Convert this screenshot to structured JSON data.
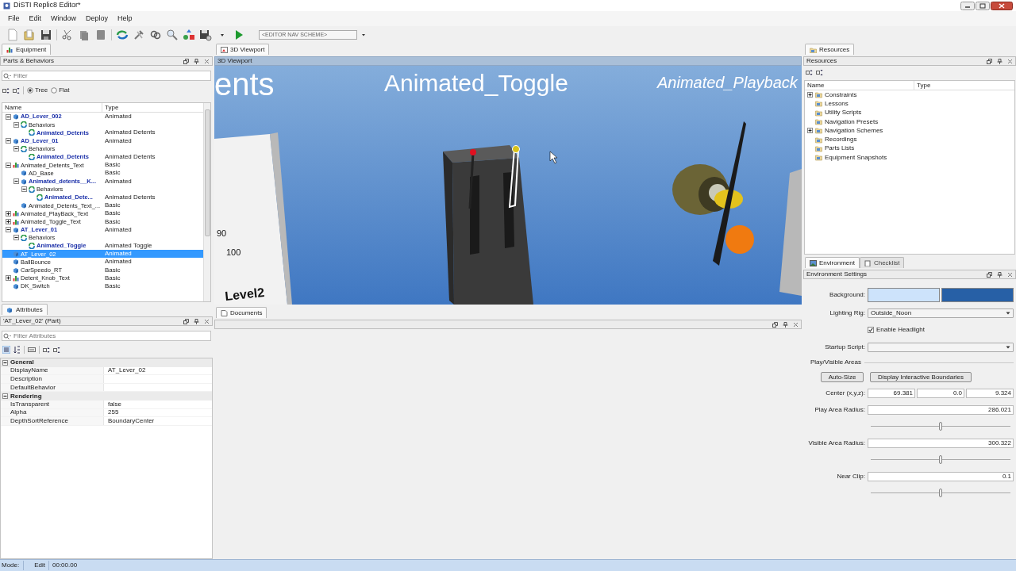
{
  "window": {
    "title": "DiSTI Replic8 Editor*"
  },
  "menu": [
    "File",
    "Edit",
    "Window",
    "Deploy",
    "Help"
  ],
  "toolbar": {
    "nav_scheme": "<EDITOR NAV SCHEME>"
  },
  "left_panel": {
    "tab": "Equipment",
    "title": "Parts & Behaviors",
    "filter_placeholder": "Filter",
    "view_modes": [
      {
        "label": "Tree",
        "selected": true
      },
      {
        "label": "Flat",
        "selected": false
      }
    ],
    "columns": [
      "Name",
      "Type"
    ],
    "tree": [
      {
        "name": "AD_Lever_002",
        "type": "Animated",
        "kind": "part",
        "emphasized": true,
        "expanded": true,
        "selected": false,
        "children": [
          {
            "name": "Behaviors",
            "kind": "behavior",
            "emphasized": false,
            "expanded": true,
            "selected": false,
            "children": [
              {
                "name": "Animated_Detents",
                "type": "Animated Detents",
                "kind": "behavior",
                "emphasized": true,
                "selected": false
              }
            ]
          }
        ]
      },
      {
        "name": "AD_Lever_01",
        "type": "Animated",
        "kind": "part",
        "emphasized": true,
        "expanded": true,
        "selected": false,
        "children": [
          {
            "name": "Behaviors",
            "kind": "behavior",
            "emphasized": false,
            "expanded": true,
            "selected": false,
            "children": [
              {
                "name": "Animated_Detents",
                "type": "Animated Detents",
                "kind": "behavior",
                "emphasized": true,
                "selected": false
              }
            ]
          }
        ]
      },
      {
        "name": "Animated_Detents_Text",
        "type": "Basic",
        "kind": "group",
        "emphasized": false,
        "expanded": true,
        "selected": false,
        "children": [
          {
            "name": "AD_Base",
            "type": "Basic",
            "kind": "part",
            "emphasized": false,
            "selected": false
          },
          {
            "name": "Animated_detents__K...",
            "type": "Animated",
            "kind": "part",
            "emphasized": true,
            "expanded": true,
            "selected": false,
            "children": [
              {
                "name": "Behaviors",
                "kind": "behavior",
                "emphasized": false,
                "expanded": true,
                "selected": false,
                "children": [
                  {
                    "name": "Animated_Dete...",
                    "type": "Animated Detents",
                    "kind": "behavior",
                    "emphasized": true,
                    "selected": false
                  }
                ]
              }
            ]
          },
          {
            "name": "Animated_Detents_Text_...",
            "type": "Basic",
            "kind": "part",
            "emphasized": false,
            "selected": false
          }
        ]
      },
      {
        "name": "Animated_PlayBack_Text",
        "type": "Basic",
        "kind": "group",
        "emphasized": false,
        "expanded": false,
        "selected": false
      },
      {
        "name": "Animated_Toggle_Text",
        "type": "Basic",
        "kind": "group",
        "emphasized": false,
        "expanded": false,
        "selected": false
      },
      {
        "name": "AT_Lever_01",
        "type": "Animated",
        "kind": "part",
        "emphasized": true,
        "expanded": true,
        "selected": false,
        "children": [
          {
            "name": "Behaviors",
            "kind": "behavior",
            "emphasized": false,
            "expanded": true,
            "selected": false,
            "children": [
              {
                "name": "Animated_Toggle",
                "type": "Animated Toggle",
                "kind": "behavior",
                "emphasized": true,
                "selected": false
              }
            ]
          }
        ]
      },
      {
        "name": "AT_Lever_02",
        "type": "Animated",
        "kind": "part",
        "emphasized": false,
        "selected": true
      },
      {
        "name": "BallBounce",
        "type": "Animated",
        "kind": "part",
        "emphasized": false,
        "selected": false
      },
      {
        "name": "CarSpeedo_RT",
        "type": "Basic",
        "kind": "part",
        "emphasized": false,
        "selected": false
      },
      {
        "name": "Detent_Knob_Text",
        "type": "Basic",
        "kind": "group",
        "emphasized": false,
        "expanded": false,
        "selected": false
      },
      {
        "name": "DK_Switch",
        "type": "Basic",
        "kind": "part",
        "emphasized": false,
        "selected": false
      }
    ]
  },
  "attributes": {
    "tab": "Attributes",
    "title": "'AT_Lever_02' (Part)",
    "filter_placeholder": "Filter Attributes",
    "groups": [
      {
        "name": "General",
        "expanded": true,
        "rows": [
          {
            "name": "DisplayName",
            "value": "AT_Lever_02"
          },
          {
            "name": "Description"
          },
          {
            "name": "DefaultBehavior"
          }
        ]
      },
      {
        "name": "Rendering",
        "expanded": true,
        "rows": [
          {
            "name": "IsTransparent",
            "value": "false"
          },
          {
            "name": "Alpha",
            "value": "255"
          },
          {
            "name": "DepthSortReference",
            "value": "BoundaryCenter"
          }
        ]
      }
    ]
  },
  "viewport": {
    "tab": "3D Viewport",
    "title": "3D Viewport",
    "scene_labels": [
      "ents",
      "Animated_Toggle",
      "Animated_Playback",
      "90",
      "100",
      "Level2"
    ]
  },
  "documents": {
    "tab": "Documents"
  },
  "resources": {
    "tab": "Resources",
    "title": "Resources",
    "columns": [
      "Name",
      "Type"
    ],
    "items": [
      {
        "name": "Constraints",
        "expanded": false
      },
      {
        "name": "Lessons"
      },
      {
        "name": "Utility Scripts"
      },
      {
        "name": "Navigation Presets"
      },
      {
        "name": "Navigation Schemes",
        "expanded": false
      },
      {
        "name": "Recordings"
      },
      {
        "name": "Parts Lists"
      },
      {
        "name": "Equipment Snapshots"
      }
    ]
  },
  "environment": {
    "tabs": [
      {
        "label": "Environment",
        "selected": true
      },
      {
        "label": "Checklist",
        "selected": false
      }
    ],
    "title": "Environment Settings",
    "background": {
      "label": "Background:",
      "swatches": [
        {
          "color": "#cde3fb"
        },
        {
          "color": "#2760a6"
        }
      ]
    },
    "lighting_rig": {
      "label": "Lighting Rig:",
      "value": "Outside_Noon"
    },
    "headlight": {
      "label": "Enable Headlight",
      "checked": true
    },
    "startup_script": {
      "label": "Startup Script:"
    },
    "section": "Play/Visible Areas",
    "buttons": [
      "Auto-Size",
      "Display Interactive Boundaries"
    ],
    "center": {
      "label": "Center (x,y,z):",
      "values": [
        "69.381",
        "0.0",
        "9.324"
      ]
    },
    "radii": [
      {
        "label": "Play Area Radius:",
        "value": "286.021",
        "level": 0.5
      },
      {
        "label": "Visible Area Radius:",
        "value": "300.322",
        "level": 0.5
      },
      {
        "label": "Near Clip:",
        "value": "0.1",
        "level": 0.5
      }
    ]
  },
  "status_bar": {
    "mode_label": "Mode:",
    "mode": "Edit",
    "time": "00:00.00"
  }
}
